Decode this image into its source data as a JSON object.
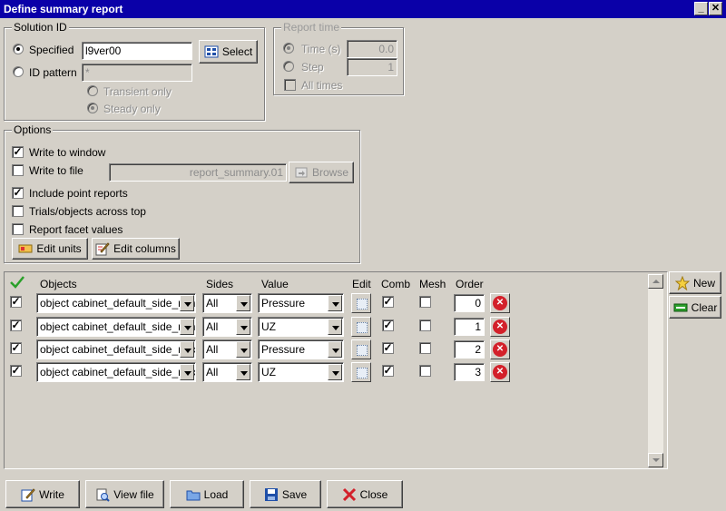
{
  "window": {
    "title": "Define summary report"
  },
  "solution_id": {
    "group_title": "Solution ID",
    "specified_label": "Specified",
    "specified_value": "l9ver00",
    "select_label": "Select",
    "id_pattern_label": "ID pattern",
    "id_pattern_value": "*",
    "transient_label": "Transient only",
    "steady_label": "Steady only"
  },
  "report_time": {
    "group_title": "Report time",
    "time_label": "Time (s)",
    "time_value": "0.0",
    "step_label": "Step",
    "step_value": "1",
    "all_times_label": "All times"
  },
  "options": {
    "group_title": "Options",
    "write_window_label": "Write to window",
    "write_file_label": "Write to file",
    "file_value": "report_summary.01",
    "browse_label": "Browse",
    "include_point_label": "Include point reports",
    "trials_label": "Trials/objects across top",
    "facet_label": "Report facet values",
    "edit_units_label": "Edit units",
    "edit_columns_label": "Edit columns"
  },
  "table": {
    "headers": {
      "objects": "Objects",
      "sides": "Sides",
      "value": "Value",
      "edit": "Edit",
      "comb": "Comb",
      "mesh": "Mesh",
      "order": "Order"
    },
    "rows": [
      {
        "object": "object cabinet_default_side_min",
        "sides": "All",
        "value": "Pressure",
        "order": "0"
      },
      {
        "object": "object cabinet_default_side_min",
        "sides": "All",
        "value": "UZ",
        "order": "1"
      },
      {
        "object": "object cabinet_default_side_max",
        "sides": "All",
        "value": "Pressure",
        "order": "2"
      },
      {
        "object": "object cabinet_default_side_max",
        "sides": "All",
        "value": "UZ",
        "order": "3"
      }
    ]
  },
  "side_buttons": {
    "new_label": "New",
    "clear_label": "Clear"
  },
  "bottom_buttons": {
    "write_label": "Write",
    "view_file_label": "View file",
    "load_label": "Load",
    "save_label": "Save",
    "close_label": "Close"
  },
  "icons": {
    "checkmark_color": "#2aa02a",
    "delete_color": "#d3202a",
    "title_bar_color": "#0a00a8"
  }
}
